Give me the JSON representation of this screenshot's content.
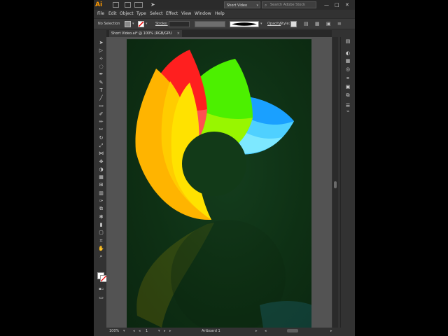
{
  "app": {
    "logo": "Ai",
    "workspace": "Short Video",
    "search_placeholder": "Search Adobe Stock",
    "window_controls": [
      "—",
      "□",
      "✕"
    ]
  },
  "menu": [
    "File",
    "Edit",
    "Object",
    "Type",
    "Select",
    "Effect",
    "View",
    "Window",
    "Help"
  ],
  "control_bar": {
    "selection_label": "No Selection",
    "stroke_label": "Stroke:",
    "opacity_label": "Opacity",
    "style_label": "Style:"
  },
  "document_tab": {
    "title": "Short Video.ai* @ 100% (RGB/GPU Preview)",
    "close_glyph": "×"
  },
  "status_bar": {
    "zoom": "100%",
    "artboard_number": "1",
    "artboard_label": "Artboard 1"
  },
  "icons": {
    "toolbar_left": [
      "selection-tool-icon",
      "direct-selection-tool-icon",
      "magic-wand-icon",
      "lasso-icon",
      "pen-tool-icon",
      "curvature-tool-icon",
      "type-tool-icon",
      "line-tool-icon",
      "rectangle-tool-icon",
      "paintbrush-icon",
      "shaper-tool-icon",
      "scissors-icon",
      "rotate-tool-icon",
      "scale-tool-icon",
      "width-tool-icon",
      "puppet-warp-icon",
      "shape-builder-icon",
      "perspective-grid-icon",
      "mesh-tool-icon",
      "gradient-tool-icon",
      "eyedropper-icon",
      "blend-tool-icon",
      "symbol-sprayer-icon",
      "column-graph-icon",
      "artboard-tool-icon",
      "slice-tool-icon",
      "hand-tool-icon",
      "zoom-tool-icon"
    ],
    "panel_right": [
      "properties-icon",
      "color-panel-icon",
      "swatches-icon",
      "stroke-panel-icon",
      "align-panel-icon",
      "transform-panel-icon",
      "pathfinder-icon",
      "layers-icon",
      "usb-icon"
    ]
  },
  "colors": {
    "artboard_bg": "#0e3014",
    "orange": "#ffb400",
    "yellow": "#ffe200",
    "red": "#ff1f1f",
    "green": "#4cf000",
    "blue": "#1aa0ff",
    "accent_logo": "#ff9a00"
  }
}
